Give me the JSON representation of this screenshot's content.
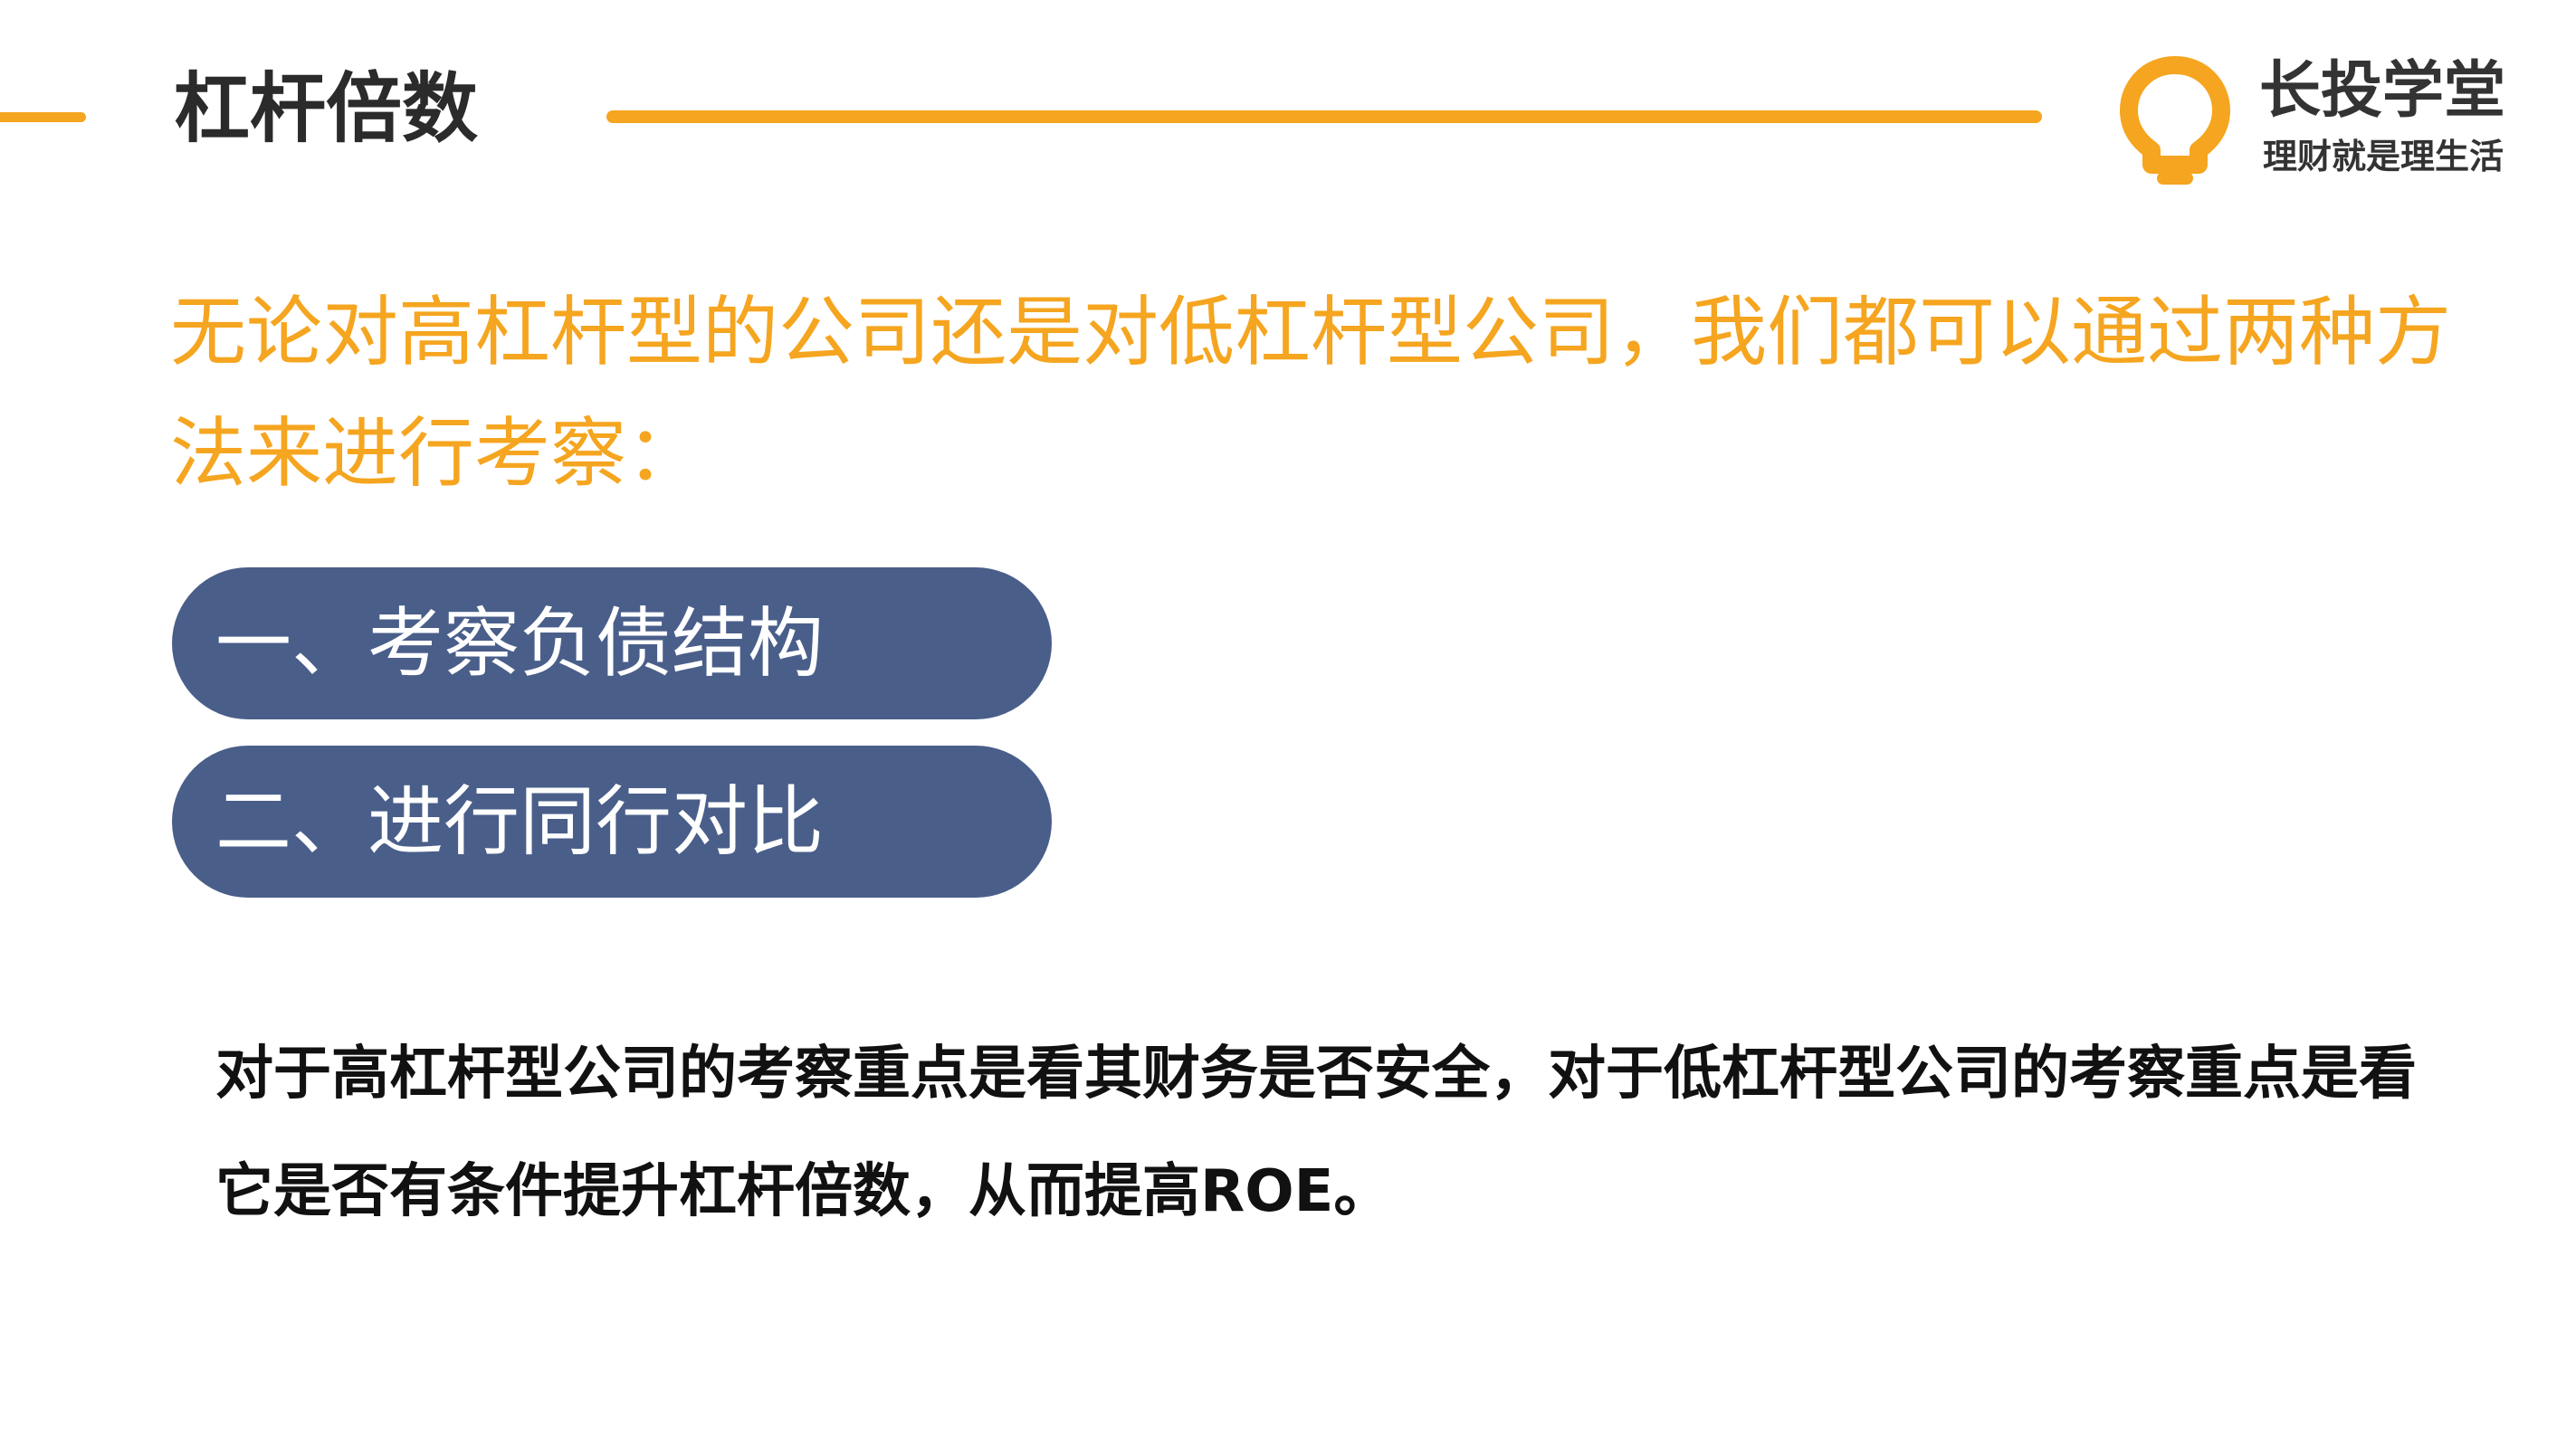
{
  "header": {
    "title": "杠杆倍数"
  },
  "brand": {
    "name": "长投学堂",
    "slogan": "理财就是理生活",
    "logo_icon": "lightbulb-icon",
    "logo_color": "#f5a51f"
  },
  "intro": {
    "text": "无论对高杠杆型的公司还是对低杠杆型公司，我们都可以通过两种方法来进行考察："
  },
  "methods": [
    {
      "label": "一、考察负债结构"
    },
    {
      "label": "二、进行同行对比"
    }
  ],
  "conclusion": {
    "text": "对于高杠杆型公司的考察重点是看其财务是否安全，对于低杠杆型公司的考察重点是看它是否有条件提升杠杆倍数，从而提高ROE。"
  },
  "colors": {
    "accent": "#f5a51f",
    "pill_background": "#4a5e8a",
    "title_text": "#2b2b2b",
    "body_text": "#111111"
  }
}
